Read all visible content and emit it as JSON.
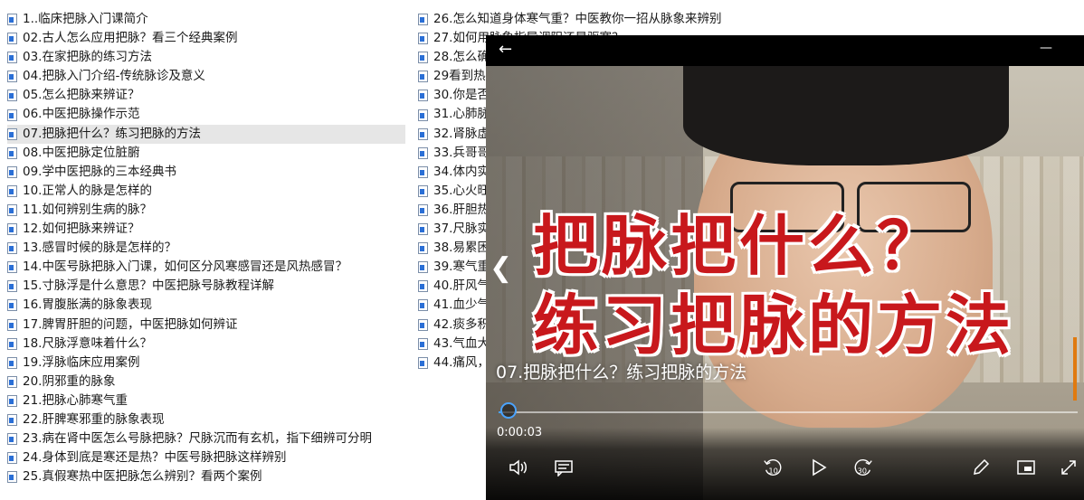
{
  "files_left": [
    "1..临床把脉入门课简介",
    "02.古人怎么应用把脉？看三个经典案例",
    "03.在家把脉的练习方法",
    "04.把脉入门介绍-传统脉诊及意义",
    "05.怎么把脉来辨证？",
    "06.中医把脉操作示范",
    "07.把脉把什么？练习把脉的方法",
    "08.中医把脉定位脏腑",
    "09.学中医把脉的三本经典书",
    "10.正常人的脉是怎样的",
    "11.如何辨别生病的脉？",
    "12.如何把脉来辨证？",
    "13.感冒时候的脉是怎样的？",
    "14.中医号脉把脉入门课，如何区分风寒感冒还是风热感冒？",
    "15.寸脉浮是什么意思？中医把脉号脉教程详解",
    "16.胃腹胀满的脉象表现",
    "17.脾胃肝胆的问题，中医把脉如何辨证",
    "18.尺脉浮意味着什么？",
    "19.浮脉临床应用案例",
    "20.阴邪重的脉象",
    "21.把脉心肺寒气重",
    "22.肝脾寒邪重的脉象表现",
    "23.病在肾中医怎么号脉把脉？尺脉沉而有玄机，指下细辨可分明",
    "24.身体到底是寒还是热？中医号脉把脉这样辨别",
    "25.真假寒热中医把脉怎么辨别？看两个案例"
  ],
  "selected_index": 6,
  "files_right": [
    "26.怎么知道身体寒气重？中医教你一招从脉象来辨别",
    "27.如何用脉象指导调阳还是驱寒？",
    "28.怎么确",
    "29看到热",
    "30.你是否",
    "31.心肺脉",
    "32.肾脉虚",
    "33.兵哥哥",
    "34.体内实",
    "35.心火旺",
    "36.肝胆热",
    "37.尺脉实",
    "38.易累困",
    "39.寒气重",
    "40.肝风气",
    "41.血少气",
    "42.痰多积",
    "43.气血大",
    "44.痛风，"
  ],
  "player": {
    "back_icon": "arrow-left-icon",
    "minimize_label": "—",
    "headline_line1": "把脉把什么？",
    "headline_line2": "练习把脉的方法",
    "caption": "07.把脉把什么？练习把脉的方法",
    "time": "0:00:03",
    "progress": 0.005,
    "skip_back": "10",
    "skip_forward": "30",
    "accent_color": "#4aa3ff",
    "headline_color": "#c8181c"
  }
}
